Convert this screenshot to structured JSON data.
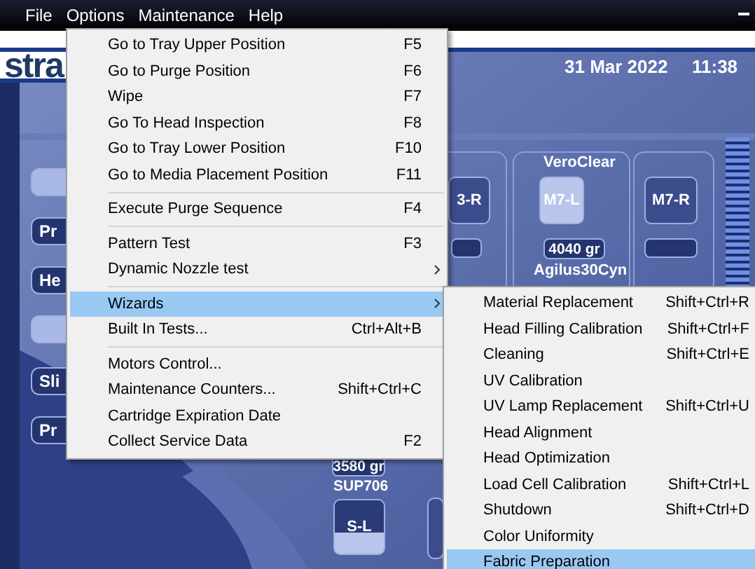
{
  "menu_bar": [
    {
      "label": "File"
    },
    {
      "label": "Options"
    },
    {
      "label": "Maintenance"
    },
    {
      "label": "Help"
    }
  ],
  "header": {
    "logo": "stra",
    "date": "31 Mar 2022",
    "time": "11:38"
  },
  "side_buttons": [
    {
      "kind": "blank"
    },
    {
      "kind": "text",
      "label": "Pr"
    },
    {
      "kind": "text",
      "label": "He"
    },
    {
      "kind": "blank"
    },
    {
      "kind": "text",
      "label": "Sli"
    },
    {
      "kind": "text",
      "label": "Pr"
    }
  ],
  "cartridges": {
    "material_top": "VeroClear",
    "slot_left": "3-R",
    "slot_center": "M7-L",
    "slot_right": "M7-R",
    "weight_top": "4040 gr",
    "material_middle": "Agilus30Cyn",
    "weight_bottom": "3580 gr",
    "material_bottom": "SUP706",
    "slot_bottom": "S-L"
  },
  "options_menu": [
    {
      "kind": "item",
      "label": "Go to Tray Upper Position",
      "shortcut": "F5",
      "submenu": false,
      "selected": false
    },
    {
      "kind": "item",
      "label": "Go to Purge Position",
      "shortcut": "F6",
      "submenu": false,
      "selected": false
    },
    {
      "kind": "item",
      "label": "Wipe",
      "shortcut": "F7",
      "submenu": false,
      "selected": false
    },
    {
      "kind": "item",
      "label": "Go To Head Inspection",
      "shortcut": "F8",
      "submenu": false,
      "selected": false
    },
    {
      "kind": "item",
      "label": "Go to Tray Lower Position",
      "shortcut": "F10",
      "submenu": false,
      "selected": false
    },
    {
      "kind": "item",
      "label": "Go to Media Placement Position",
      "shortcut": "F11",
      "submenu": false,
      "selected": false
    },
    {
      "kind": "separator"
    },
    {
      "kind": "item",
      "label": "Execute Purge Sequence",
      "shortcut": "F4",
      "submenu": false,
      "selected": false
    },
    {
      "kind": "separator"
    },
    {
      "kind": "item",
      "label": "Pattern Test",
      "shortcut": "F3",
      "submenu": false,
      "selected": false
    },
    {
      "kind": "item",
      "label": "Dynamic Nozzle test",
      "submenu": true,
      "selected": false
    },
    {
      "kind": "separator"
    },
    {
      "kind": "item",
      "label": "Wizards",
      "submenu": true,
      "selected": true
    },
    {
      "kind": "item",
      "label": "Built In Tests...",
      "shortcut": "Ctrl+Alt+B",
      "submenu": false,
      "selected": false
    },
    {
      "kind": "separator"
    },
    {
      "kind": "item",
      "label": "Motors Control...",
      "submenu": false,
      "selected": false
    },
    {
      "kind": "item",
      "label": "Maintenance Counters...",
      "shortcut": "Shift+Ctrl+C",
      "submenu": false,
      "selected": false
    },
    {
      "kind": "item",
      "label": "Cartridge Expiration Date",
      "submenu": false,
      "selected": false
    },
    {
      "kind": "item",
      "label": "Collect Service Data",
      "shortcut": "F2",
      "submenu": false,
      "selected": false
    }
  ],
  "wizards_submenu": [
    {
      "label": "Material Replacement",
      "shortcut": "Shift+Ctrl+R",
      "selected": false
    },
    {
      "label": "Head Filling Calibration",
      "shortcut": "Shift+Ctrl+F",
      "selected": false
    },
    {
      "label": "Cleaning",
      "shortcut": "Shift+Ctrl+E",
      "selected": false
    },
    {
      "label": "UV Calibration",
      "selected": false
    },
    {
      "label": "UV Lamp Replacement",
      "shortcut": "Shift+Ctrl+U",
      "selected": false
    },
    {
      "label": "Head Alignment",
      "selected": false
    },
    {
      "label": "Head Optimization",
      "selected": false
    },
    {
      "label": "Load Cell Calibration",
      "shortcut": "Shift+Ctrl+L",
      "selected": false
    },
    {
      "label": "Shutdown",
      "shortcut": "Shift+Ctrl+D",
      "selected": false
    },
    {
      "label": "Color Uniformity",
      "selected": false
    },
    {
      "label": "Fabric Preparation",
      "selected": true
    }
  ]
}
